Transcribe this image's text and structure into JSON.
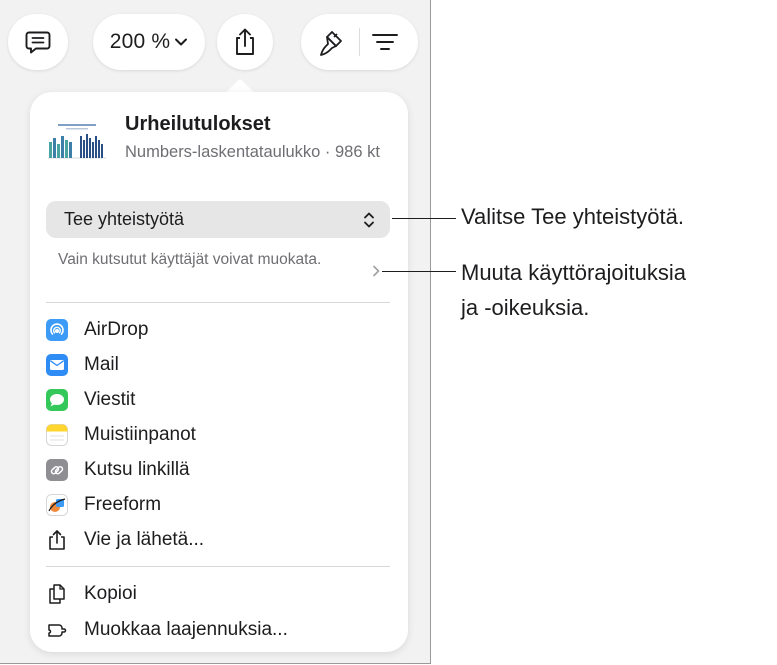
{
  "toolbar": {
    "zoom_label": "200 %"
  },
  "share_popover": {
    "document": {
      "title": "Urheilutulokset",
      "meta": "Numbers-laskentataulukko · 986 kt"
    },
    "collaboration_select": {
      "value": "Tee yhteistyötä"
    },
    "permissions": {
      "text": "Vain kutsutut käyttäjät voivat muokata."
    },
    "share_items": [
      {
        "label": "AirDrop",
        "icon": "airdrop-icon"
      },
      {
        "label": "Mail",
        "icon": "mail-icon"
      },
      {
        "label": "Viestit",
        "icon": "messages-icon"
      },
      {
        "label": "Muistiinpanot",
        "icon": "notes-icon"
      },
      {
        "label": "Kutsu linkillä",
        "icon": "link-icon"
      },
      {
        "label": "Freeform",
        "icon": "freeform-icon"
      },
      {
        "label": "Vie ja lähetä...",
        "icon": "export-icon"
      }
    ],
    "action_items": [
      {
        "label": "Kopioi",
        "icon": "copy-icon"
      },
      {
        "label": "Muokkaa laajennuksia...",
        "icon": "extensions-icon"
      }
    ]
  },
  "callouts": [
    {
      "text": "Valitse Tee yhteistyötä."
    },
    {
      "line1": "Muuta käyttörajoituksia",
      "line2": "ja -oikeuksia."
    }
  ],
  "colors": {
    "window_bg": "#f2f2f2",
    "popover_bg": "#ffffff",
    "airdrop": "#3b9bf7",
    "mail": "#2f8cf5",
    "messages": "#34c759",
    "notes": "#ffd52e",
    "link": "#8e8e93"
  }
}
